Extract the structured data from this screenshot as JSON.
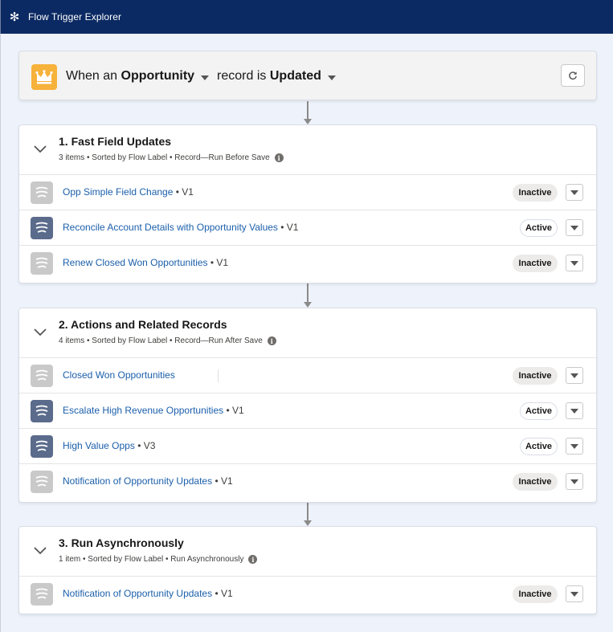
{
  "app": {
    "title": "Flow Trigger Explorer"
  },
  "trigger": {
    "prefix": "When an",
    "object": "Opportunity",
    "middle": "record is",
    "event": "Updated"
  },
  "sections": [
    {
      "title": "1. Fast Field Updates",
      "subtitle": "3 items • Sorted by Flow Label • Record—Run Before Save",
      "rows": [
        {
          "label": "Opp Simple Field Change",
          "version": "• V1",
          "status": "Inactive",
          "active": false
        },
        {
          "label": "Reconcile Account Details with Opportunity Values",
          "version": "• V1",
          "status": "Active",
          "active": true
        },
        {
          "label": "Renew Closed Won Opportunities",
          "version": "• V1",
          "status": "Inactive",
          "active": false
        }
      ]
    },
    {
      "title": "2. Actions and Related Records",
      "subtitle": "4 items • Sorted by Flow Label • Record—Run After Save",
      "rows": [
        {
          "label": "Closed Won Opportunities",
          "version": "",
          "status": "Inactive",
          "active": false
        },
        {
          "label": "Escalate High Revenue Opportunities",
          "version": "• V1",
          "status": "Active",
          "active": true
        },
        {
          "label": "High Value Opps",
          "version": "• V3",
          "status": "Active",
          "active": true
        },
        {
          "label": "Notification of Opportunity Updates",
          "version": "• V1",
          "status": "Inactive",
          "active": false
        }
      ]
    },
    {
      "title": "3. Run Asynchronously",
      "subtitle": "1 item • Sorted by Flow Label • Run Asynchronously",
      "rows": [
        {
          "label": "Notification of Opportunity Updates",
          "version": "• V1",
          "status": "Inactive",
          "active": false
        }
      ]
    }
  ],
  "icons": {
    "app": "asterisk-icon",
    "trigger": "crown-icon",
    "refresh": "refresh-icon",
    "collapse": "chevron-down-icon",
    "flow": "flow-icon",
    "info": "info-icon",
    "menu": "down-triangle-icon"
  },
  "colors": {
    "header": "#0b2a63",
    "accent_link": "#1b5fab",
    "crown_bg": "#f7b23b",
    "active_flow_icon": "#5b6b8c",
    "inactive_flow_icon": "#c9c9c9"
  }
}
